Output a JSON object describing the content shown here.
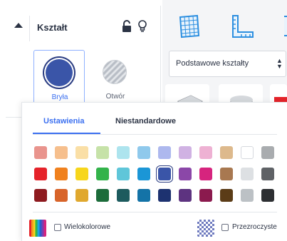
{
  "shape_panel": {
    "title": "Kształt",
    "icons": {
      "collapse": "triangle-up-icon",
      "lock": "unlock-icon",
      "light": "lightbulb-icon"
    },
    "solid": {
      "label": "Bryła",
      "color": "#3a55a8",
      "selected": true
    },
    "hole": {
      "label": "Otwór",
      "selected": false
    }
  },
  "shapes_panel": {
    "tools": [
      {
        "name": "grid-tool-icon",
        "color": "#2d8fe0"
      },
      {
        "name": "ruler-tool-icon",
        "color": "#2d8fe0"
      },
      {
        "name": "note-tool-icon",
        "color": "#2d8fe0"
      }
    ],
    "category": {
      "value": "Podstawowe kształty",
      "icon": "up-down-arrows-icon"
    }
  },
  "color_popup": {
    "tabs": [
      {
        "label": "Ustawienia",
        "active": true
      },
      {
        "label": "Niestandardowe",
        "active": false
      }
    ],
    "selected_color": "#3a55a8",
    "swatch_rows": [
      [
        "#e9948d",
        "#f6bf8d",
        "#fadfa6",
        "#c6e2a8",
        "#ade4ee",
        "#8fc9ec",
        "#adb8ee",
        "#d0b2e3",
        "#eeb1d3",
        "#ddb98c",
        "#ffffff",
        "#a9acaf"
      ],
      [
        "#e5232a",
        "#f0811e",
        "#f7d61c",
        "#33b34a",
        "#5fc6d9",
        "#1b96d6",
        "#3a55a8",
        "#8b47a8",
        "#d6247e",
        "#a87850",
        "#dde0e3",
        "#5f6266"
      ],
      [
        "#8e1a1f",
        "#d8642a",
        "#e0a82e",
        "#1c6c3a",
        "#1d5b5e",
        "#1473a7",
        "#1d3270",
        "#5d3380",
        "#8b1a4e",
        "#5b3c17",
        "#bcc1c5",
        "#2d2f32"
      ]
    ],
    "multicolor": {
      "label": "Wielokolorowe",
      "checked": false
    },
    "transparent": {
      "label": "Przezroczyste",
      "checked": false
    }
  }
}
